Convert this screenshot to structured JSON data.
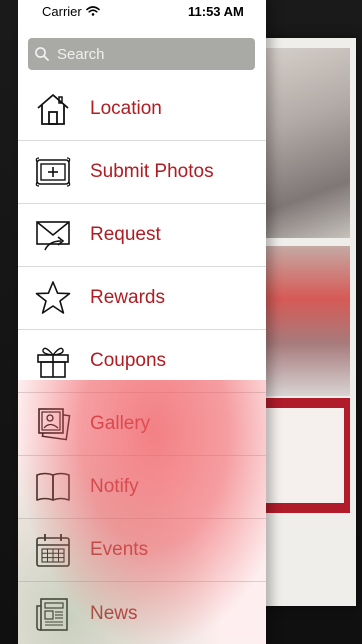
{
  "status_bar": {
    "carrier": "Carrier",
    "time": "11:53 AM",
    "wifi_icon": "wifi-icon"
  },
  "search": {
    "placeholder": "Search",
    "icon": "search-icon"
  },
  "menu": {
    "items": [
      {
        "label": "Location",
        "icon": "house-icon"
      },
      {
        "label": "Submit Photos",
        "icon": "framed-plus-icon"
      },
      {
        "label": "Request",
        "icon": "envelope-arrow-icon"
      },
      {
        "label": "Rewards",
        "icon": "star-icon"
      },
      {
        "label": "Coupons",
        "icon": "gift-icon"
      },
      {
        "label": "Gallery",
        "icon": "photos-icon"
      },
      {
        "label": "Notify",
        "icon": "book-icon"
      },
      {
        "label": "Events",
        "icon": "calendar-icon"
      },
      {
        "label": "News",
        "icon": "newspaper-icon"
      }
    ]
  },
  "colors": {
    "menu_label": "#b01c22",
    "search_bg": "#a9a9a6",
    "drawer_bg": "#ffffff",
    "divider": "#d9d9d9"
  }
}
